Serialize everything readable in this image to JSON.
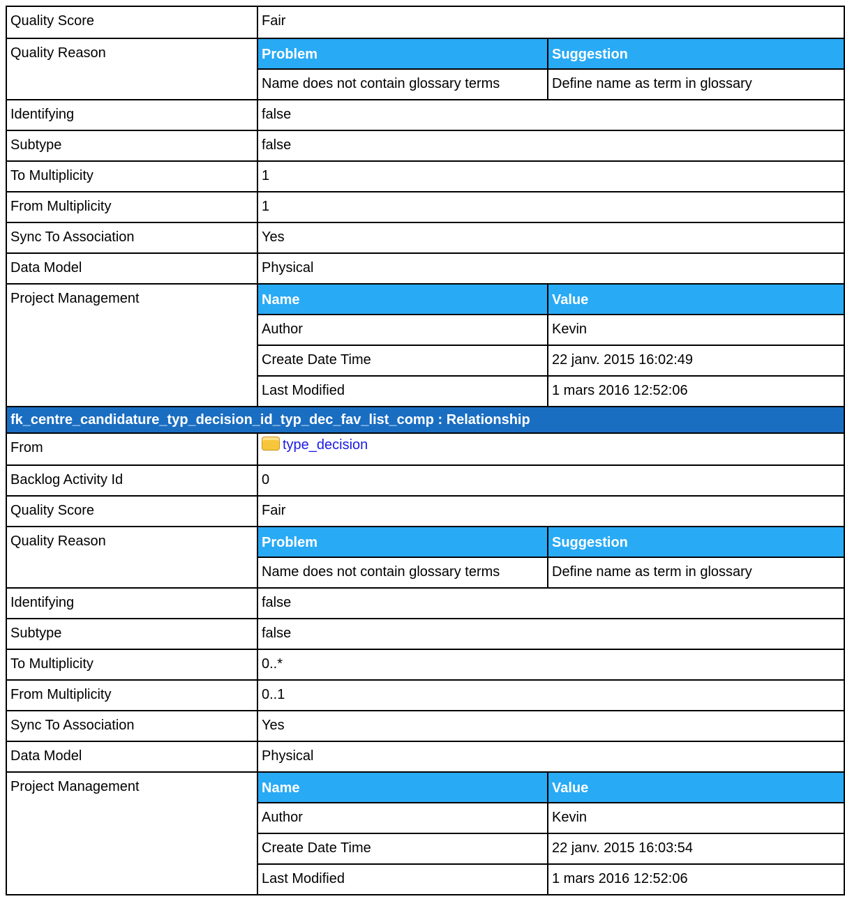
{
  "section1": {
    "quality_score": {
      "label": "Quality Score",
      "value": "Fair"
    },
    "quality_reason": {
      "label": "Quality Reason",
      "headers": [
        "Problem",
        "Suggestion"
      ],
      "rows": [
        [
          "Name does not contain glossary terms",
          "Define name as term in glossary"
        ]
      ]
    },
    "identifying": {
      "label": "Identifying",
      "value": "false"
    },
    "subtype": {
      "label": "Subtype",
      "value": "false"
    },
    "to_multiplicity": {
      "label": "To Multiplicity",
      "value": "1"
    },
    "from_multiplicity": {
      "label": "From Multiplicity",
      "value": "1"
    },
    "sync_to_association": {
      "label": "Sync To Association",
      "value": "Yes"
    },
    "data_model": {
      "label": "Data Model",
      "value": "Physical"
    },
    "project_management": {
      "label": "Project Management",
      "headers": [
        "Name",
        "Value"
      ],
      "rows": [
        [
          "Author",
          "Kevin"
        ],
        [
          "Create Date Time",
          "22 janv. 2015 16:02:49"
        ],
        [
          "Last Modified",
          "1 mars 2016 12:52:06"
        ]
      ]
    }
  },
  "section2": {
    "title": "fk_centre_candidature_typ_decision_id_typ_dec_fav_list_comp : Relationship",
    "from": {
      "label": "From",
      "link_text": "type_decision",
      "icon": "table-folder-icon"
    },
    "backlog_activity_id": {
      "label": "Backlog Activity Id",
      "value": "0"
    },
    "quality_score": {
      "label": "Quality Score",
      "value": "Fair"
    },
    "quality_reason": {
      "label": "Quality Reason",
      "headers": [
        "Problem",
        "Suggestion"
      ],
      "rows": [
        [
          "Name does not contain glossary terms",
          "Define name as term in glossary"
        ]
      ]
    },
    "identifying": {
      "label": "Identifying",
      "value": "false"
    },
    "subtype": {
      "label": "Subtype",
      "value": "false"
    },
    "to_multiplicity": {
      "label": "To Multiplicity",
      "value": "0..*"
    },
    "from_multiplicity": {
      "label": "From Multiplicity",
      "value": "0..1"
    },
    "sync_to_association": {
      "label": "Sync To Association",
      "value": "Yes"
    },
    "data_model": {
      "label": "Data Model",
      "value": "Physical"
    },
    "project_management": {
      "label": "Project Management",
      "headers": [
        "Name",
        "Value"
      ],
      "rows": [
        [
          "Author",
          "Kevin"
        ],
        [
          "Create Date Time",
          "22 janv. 2015 16:03:54"
        ],
        [
          "Last Modified",
          "1 mars 2016 12:52:06"
        ]
      ]
    }
  },
  "colors": {
    "section_header_bg": "#1a6ec2",
    "subtable_header_bg": "#29aaf5",
    "link": "#1a1ae6"
  }
}
